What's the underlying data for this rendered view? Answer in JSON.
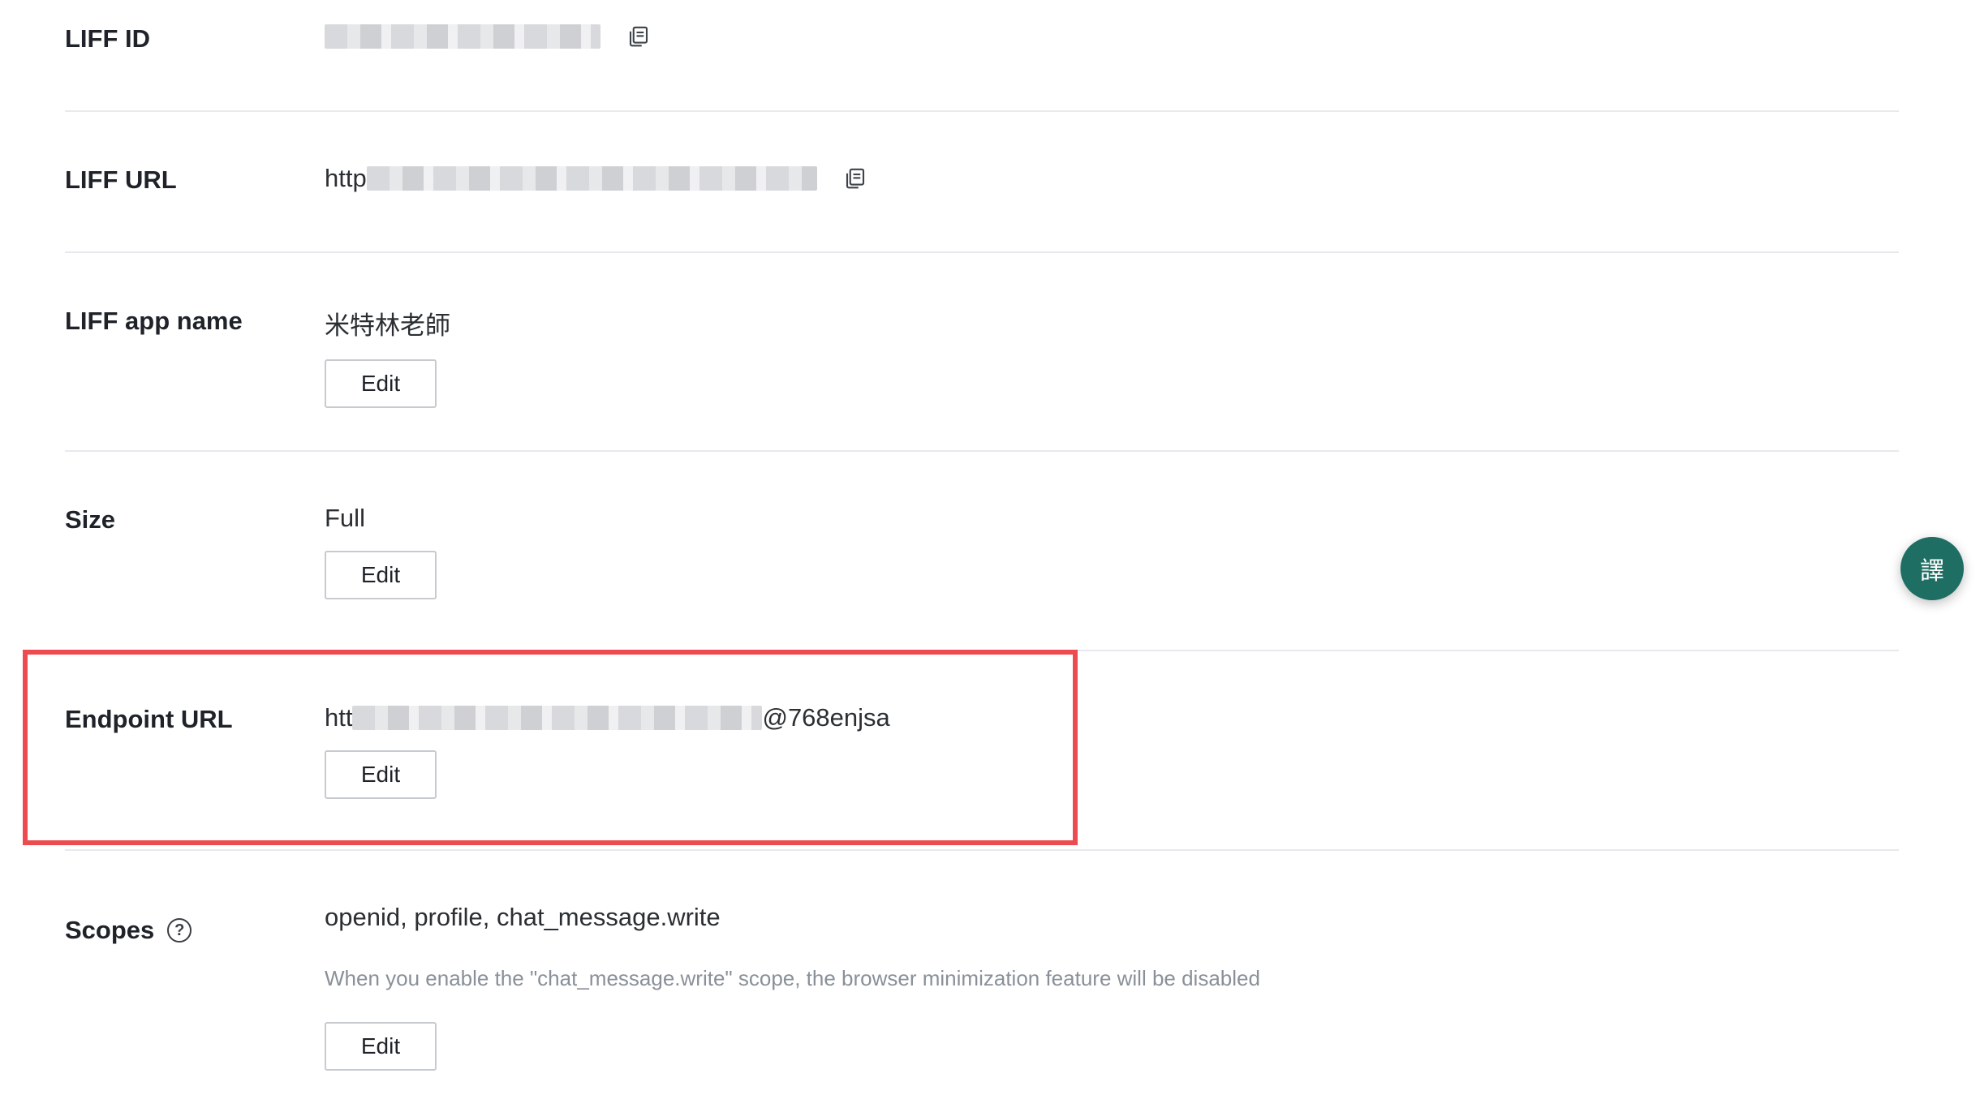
{
  "rows": {
    "liff_id": {
      "label": "LIFF ID"
    },
    "liff_url": {
      "label": "LIFF URL",
      "value_prefix": "http"
    },
    "app_name": {
      "label": "LIFF app name",
      "value": "米特林老師",
      "edit_label": "Edit"
    },
    "size": {
      "label": "Size",
      "value": "Full",
      "edit_label": "Edit"
    },
    "endpoint_url": {
      "label": "Endpoint URL",
      "value_prefix": "htt",
      "value_suffix": "@768enjsa",
      "edit_label": "Edit"
    },
    "scopes": {
      "label": "Scopes",
      "help_icon_glyph": "?",
      "value": "openid, profile, chat_message.write",
      "hint": "When you enable the \"chat_message.write\" scope, the browser minimization feature will be disabled",
      "edit_label": "Edit"
    }
  },
  "icons": {
    "copy": "copy-icon",
    "help": "help-circle-icon",
    "translate": "translate-icon"
  },
  "translate_fab": {
    "glyph": "譯"
  },
  "colors": {
    "highlight": "#ec4b4f",
    "fab": "#1e6e63",
    "divider": "#e7e9ec",
    "hint": "#8a9099"
  }
}
